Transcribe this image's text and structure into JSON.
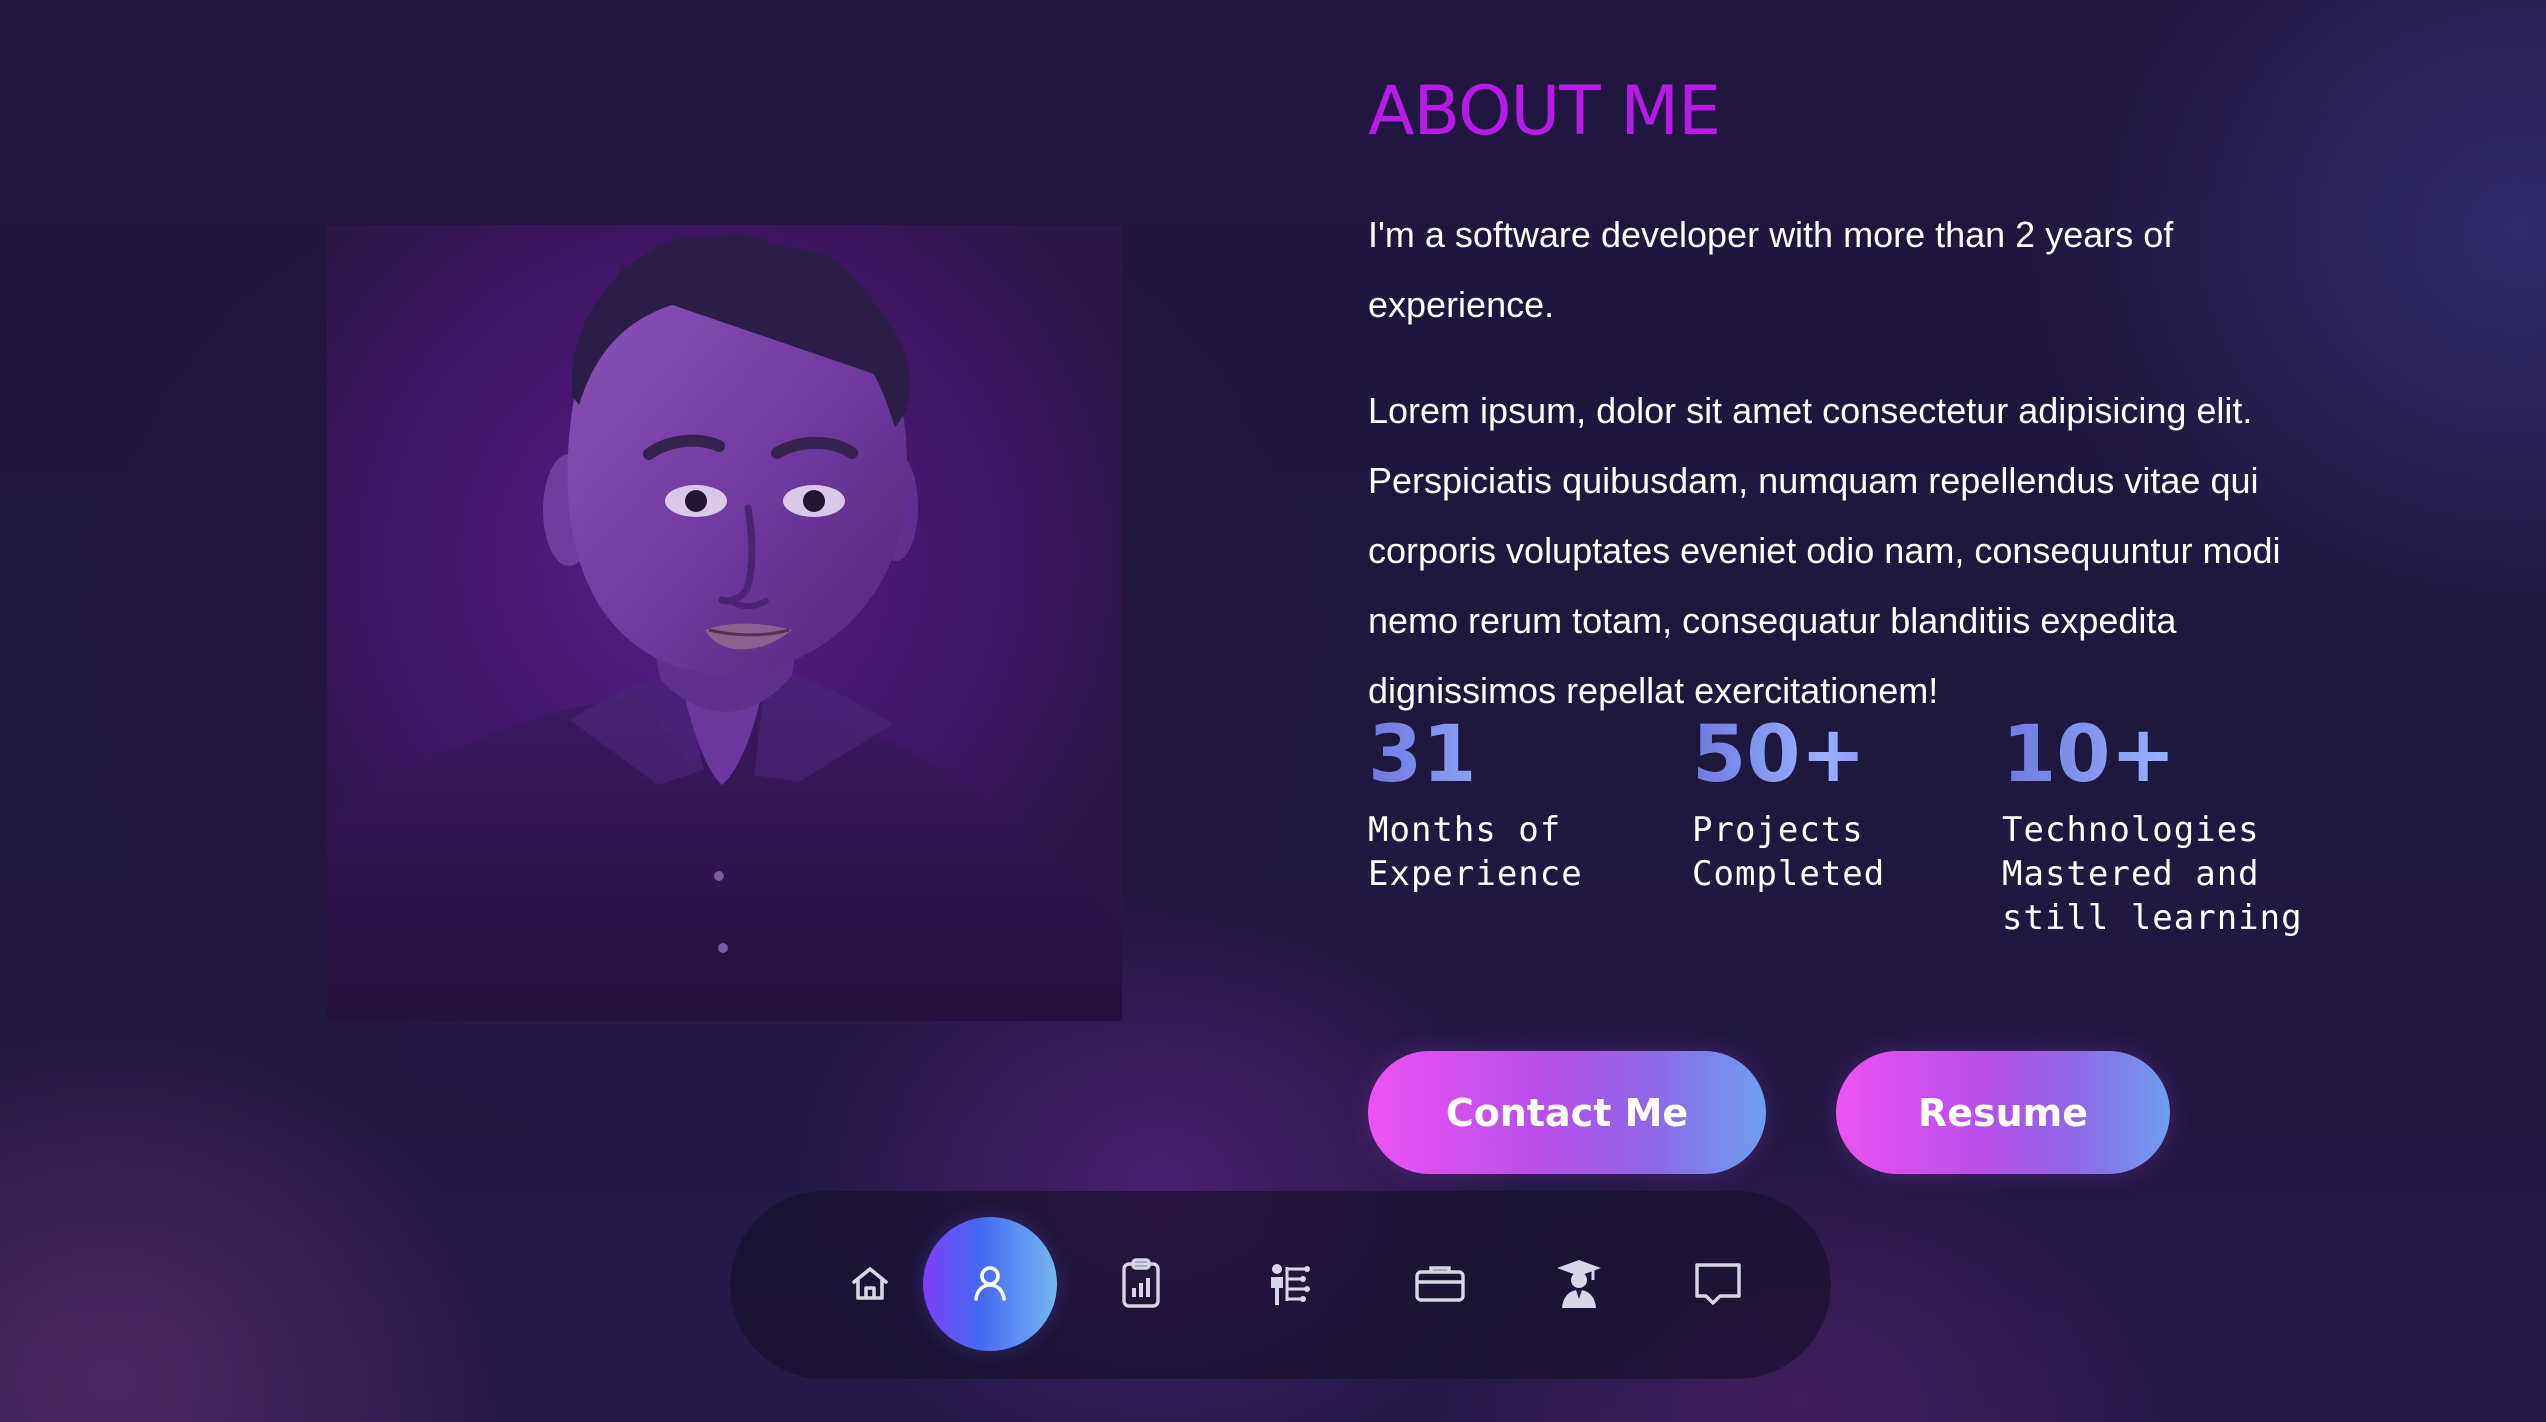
{
  "about": {
    "title": "ABOUT ME",
    "paragraphs": [
      "I'm a software developer with more than 2 years of experience.",
      "Lorem ipsum, dolor sit amet consectetur adipisicing elit. Perspiciatis quibusdam, numquam repellendus vitae qui corporis voluptates eveniet odio nam, consequuntur modi nemo rerum totam, consequatur blanditiis expedita dignissimos repellat exercitationem!"
    ]
  },
  "stats": [
    {
      "value": "31",
      "label": "Months of Experience"
    },
    {
      "value": "50+",
      "label": "Projects Completed"
    },
    {
      "value": "10+",
      "label": "Technologies Mastered and still learning"
    }
  ],
  "buttons": {
    "contact": "Contact Me",
    "resume": "Resume"
  },
  "nav": {
    "items": [
      {
        "icon": "home-icon",
        "active": false
      },
      {
        "icon": "user-icon",
        "active": true
      },
      {
        "icon": "chart-clipboard-icon",
        "active": false
      },
      {
        "icon": "person-presentation-icon",
        "active": false
      },
      {
        "icon": "briefcase-icon",
        "active": false
      },
      {
        "icon": "graduate-icon",
        "active": false
      },
      {
        "icon": "chat-icon",
        "active": false
      }
    ]
  },
  "colors": {
    "background": "#1e173e",
    "title": "#b61be8",
    "accent_pink": "#ec52f0",
    "accent_blue": "#6e9ff0",
    "active_nav": "#4468f3",
    "stat_blue": "#8fb0ff"
  }
}
